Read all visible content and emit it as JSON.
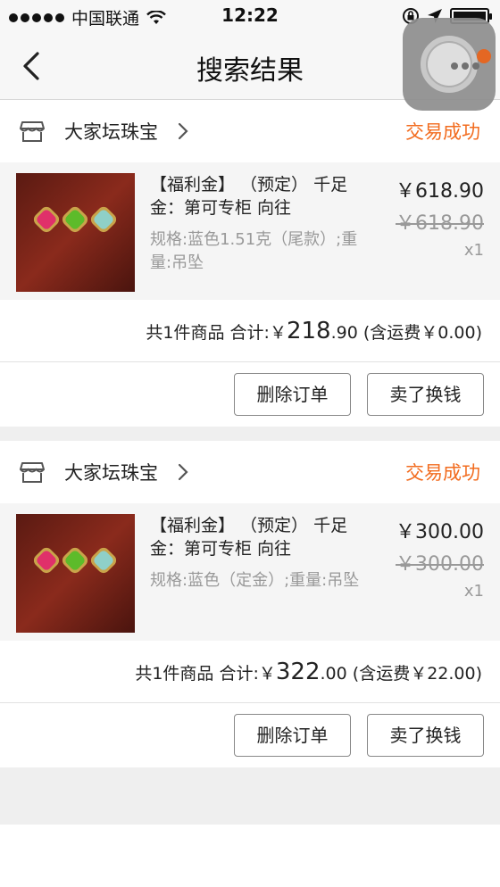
{
  "status_bar": {
    "carrier": "中国联通",
    "time": "12:22"
  },
  "nav": {
    "title": "搜索结果",
    "back_icon": "chevron-left-icon"
  },
  "theme": {
    "accent": "#f26c1f",
    "muted_text": "#999999",
    "section_bg": "#f5f5f5"
  },
  "orders": [
    {
      "shop_name": "大家坛珠宝",
      "status": "交易成功",
      "item": {
        "title": "【福利金】 （预定） 千足金：第可专柜 向往",
        "spec": "规格:蓝色1.51克（尾款）;重量:吊坠",
        "price": "￥618.90",
        "original_price": "￥618.90",
        "quantity": "x1"
      },
      "summary": {
        "prefix": "共1件商品 合计:￥",
        "total_int": "218",
        "total_dec": ".90",
        "shipping": "(含运费￥0.00)"
      },
      "actions": {
        "delete": "删除订单",
        "sell": "卖了换钱"
      }
    },
    {
      "shop_name": "大家坛珠宝",
      "status": "交易成功",
      "item": {
        "title": "【福利金】 （预定） 千足金：第可专柜 向往",
        "spec": "规格:蓝色（定金）;重量:吊坠",
        "price": "￥300.00",
        "original_price": "￥300.00",
        "quantity": "x1"
      },
      "summary": {
        "prefix": "共1件商品 合计:￥",
        "total_int": "322",
        "total_dec": ".00",
        "shipping": "(含运费￥22.00)"
      },
      "actions": {
        "delete": "删除订单",
        "sell": "卖了换钱"
      }
    }
  ]
}
